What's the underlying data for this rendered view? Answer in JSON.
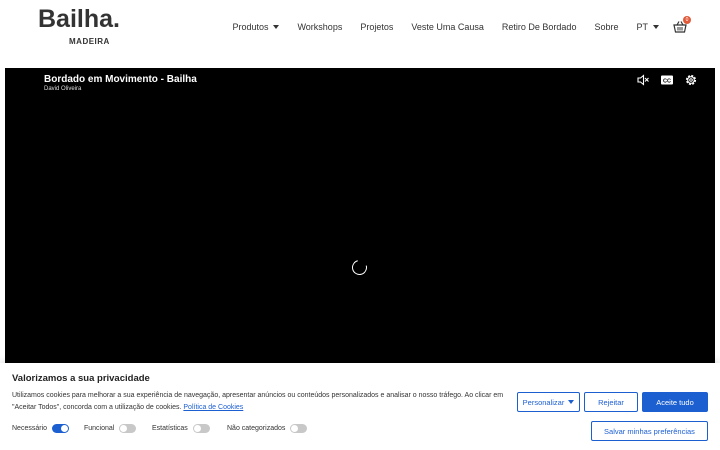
{
  "header": {
    "logo_main": "Bailha.",
    "logo_sub": "MADEIRA",
    "nav": [
      {
        "label": "Produtos"
      },
      {
        "label": "Workshops"
      },
      {
        "label": "Projetos"
      },
      {
        "label": "Veste Uma Causa"
      },
      {
        "label": "Retiro De Bordado"
      },
      {
        "label": "Sobre"
      }
    ],
    "language": "PT",
    "cart_count": "0"
  },
  "video": {
    "title": "Bordado em Movimento - Bailha",
    "author": "David Oliveira",
    "icons": [
      "mute-icon",
      "captions-icon",
      "settings-icon",
      "loading-spinner-icon"
    ]
  },
  "cookie": {
    "title": "Valorizamos a sua privacidade",
    "text": "Utilizamos cookies para melhorar a sua experiência de navegação, apresentar anúncios ou conteúdos personalizados e analisar o nosso tráfego. Ao clicar em \"Aceitar Todos\", concorda com a utilização de cookies.",
    "link": "Política de Cookies",
    "toggles": [
      {
        "label": "Necessário",
        "on": true
      },
      {
        "label": "Funcional",
        "on": false
      },
      {
        "label": "Estatísticas",
        "on": false
      },
      {
        "label": "Não categorizados",
        "on": false
      }
    ],
    "buttons": {
      "customize": "Personalizar",
      "reject": "Rejeitar",
      "accept": "Aceite tudo",
      "save": "Salvar minhas preferências"
    },
    "accent_color": "#1c5fd1"
  }
}
